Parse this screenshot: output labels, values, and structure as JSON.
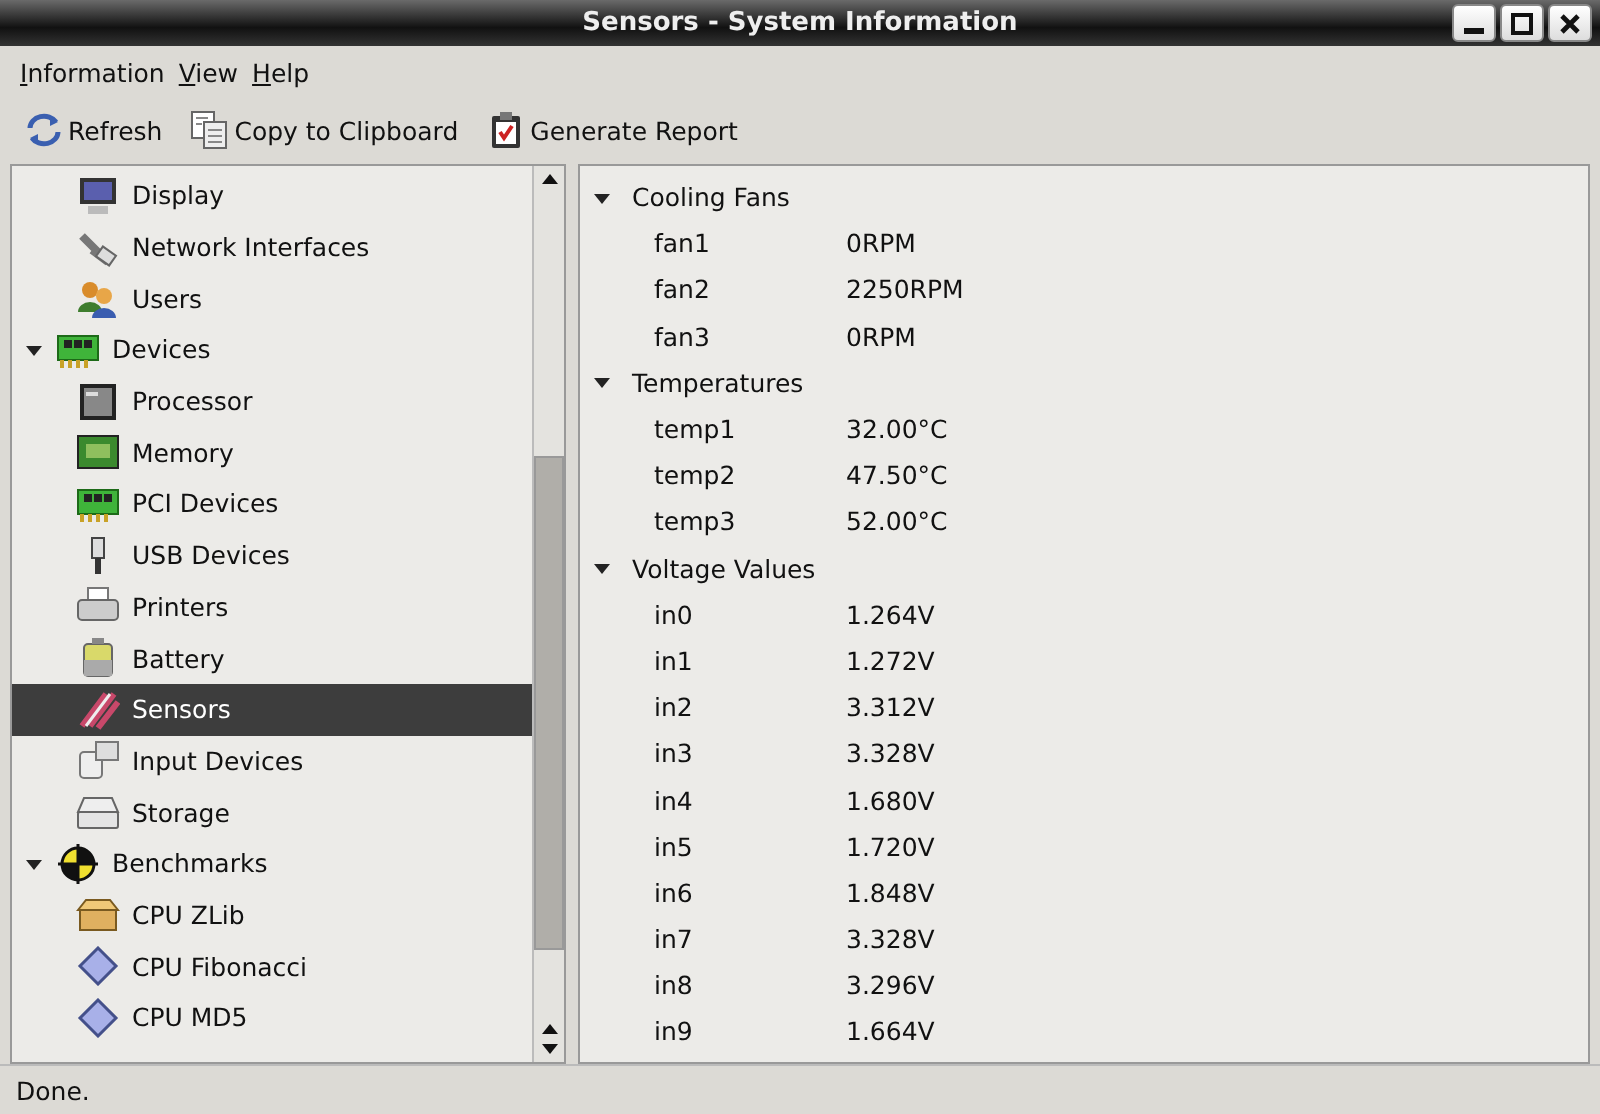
{
  "window": {
    "title": "Sensors - System Information"
  },
  "menu": [
    {
      "mnemonic": "I",
      "rest": "nformation"
    },
    {
      "mnemonic": "V",
      "rest": "iew"
    },
    {
      "mnemonic": "H",
      "rest": "elp"
    }
  ],
  "toolbar": [
    "Refresh",
    "Copy to Clipboard",
    "Generate Report"
  ],
  "sidebar": {
    "items": [
      {
        "children": [
          {
            "label": "Display",
            "selected": false
          },
          {
            "label": "Network Interfaces",
            "selected": false
          },
          {
            "label": "Users",
            "selected": false
          }
        ]
      },
      {
        "label": "Devices",
        "expanded": true,
        "selected": false,
        "children": [
          {
            "label": "Processor",
            "selected": false
          },
          {
            "label": "Memory",
            "selected": false
          },
          {
            "label": "PCI Devices",
            "selected": false
          },
          {
            "label": "USB Devices",
            "selected": false
          },
          {
            "label": "Printers",
            "selected": false
          },
          {
            "label": "Battery",
            "selected": false
          },
          {
            "label": "Sensors",
            "selected": true
          },
          {
            "label": "Input Devices",
            "selected": false
          },
          {
            "label": "Storage",
            "selected": false
          }
        ]
      },
      {
        "label": "Benchmarks",
        "expanded": true,
        "selected": false,
        "children": [
          {
            "label": "CPU ZLib",
            "selected": false
          },
          {
            "label": "CPU Fibonacci",
            "selected": false
          },
          {
            "label": "CPU MD5",
            "selected": false
          }
        ]
      }
    ]
  },
  "details": [
    {
      "title": "Cooling Fans",
      "expanded": true,
      "rows": [
        [
          "fan1",
          "0RPM"
        ],
        [
          "fan2",
          "2250RPM"
        ],
        [
          "fan3",
          "0RPM"
        ]
      ]
    },
    {
      "title": "Temperatures",
      "expanded": true,
      "rows": [
        [
          "temp1",
          "32.00°C"
        ],
        [
          "temp2",
          "47.50°C"
        ],
        [
          "temp3",
          "52.00°C"
        ]
      ]
    },
    {
      "title": "Voltage Values",
      "expanded": true,
      "rows": [
        [
          "in0",
          "1.264V"
        ],
        [
          "in1",
          "1.272V"
        ],
        [
          "in2",
          "3.312V"
        ],
        [
          "in3",
          "3.328V"
        ],
        [
          "in4",
          "1.680V"
        ],
        [
          "in5",
          "1.720V"
        ],
        [
          "in6",
          "1.848V"
        ],
        [
          "in7",
          "3.328V"
        ],
        [
          "in8",
          "3.296V"
        ],
        [
          "in9",
          "1.664V"
        ]
      ]
    }
  ],
  "status_bar": "Done."
}
